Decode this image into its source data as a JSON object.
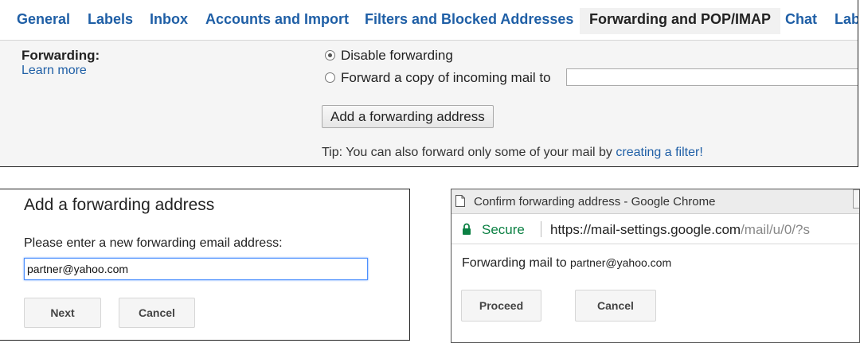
{
  "tabs": [
    {
      "label": "General"
    },
    {
      "label": "Labels"
    },
    {
      "label": "Inbox"
    },
    {
      "label": "Accounts and Import"
    },
    {
      "label": "Filters and Blocked Addresses"
    },
    {
      "label": "Forwarding and POP/IMAP",
      "active": true
    },
    {
      "label": "Chat"
    },
    {
      "label": "Lab"
    }
  ],
  "forwarding": {
    "label": "Forwarding:",
    "learn_more": "Learn more",
    "option_disable": "Disable forwarding",
    "option_forward": "Forward a copy of incoming mail to",
    "selected": "disable",
    "add_button": "Add a forwarding address",
    "tip_prefix": "Tip: You can also forward only some of your mail by ",
    "tip_link": "creating a filter!"
  },
  "add_dialog": {
    "title": "Add a forwarding address",
    "prompt": "Please enter a new forwarding email address:",
    "email_value": "partner@yahoo.com",
    "next_label": "Next",
    "cancel_label": "Cancel"
  },
  "confirm_window": {
    "title": "Confirm forwarding address - Google Chrome",
    "secure_label": "Secure",
    "url_host": "https://mail-settings.google.com",
    "url_path": "/mail/u/0/?s",
    "message_prefix": "Forwarding mail to ",
    "email": "partner@yahoo.com",
    "proceed_label": "Proceed",
    "cancel_label": "Cancel",
    "secure_color": "#0b8043"
  },
  "icons": {
    "document": "document-icon",
    "lock": "lock-icon"
  }
}
